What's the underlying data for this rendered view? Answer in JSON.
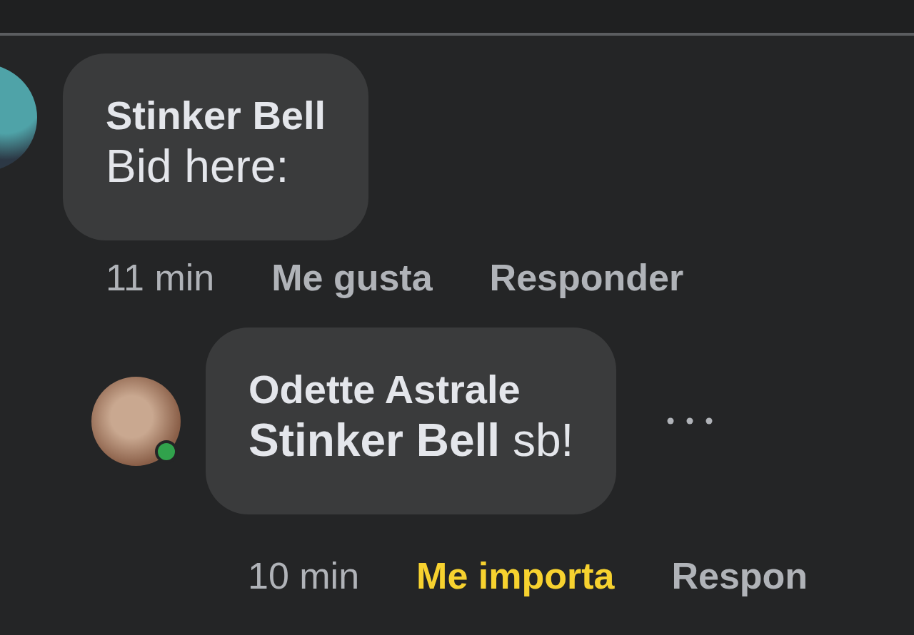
{
  "comments": [
    {
      "author": "Stinker Bell",
      "text": "Bid here:",
      "time": "11 min",
      "reaction": {
        "label": "Me gusta",
        "reacted": false
      },
      "reply_label": "Responder",
      "replies": [
        {
          "author": "Odette Astrale",
          "text": "**Stinker Bell** sb!",
          "online": true,
          "time": "10 min",
          "reaction": {
            "label": "Me importa",
            "reacted": true
          },
          "reply_label": "Respon",
          "show_more": true
        }
      ]
    }
  ]
}
